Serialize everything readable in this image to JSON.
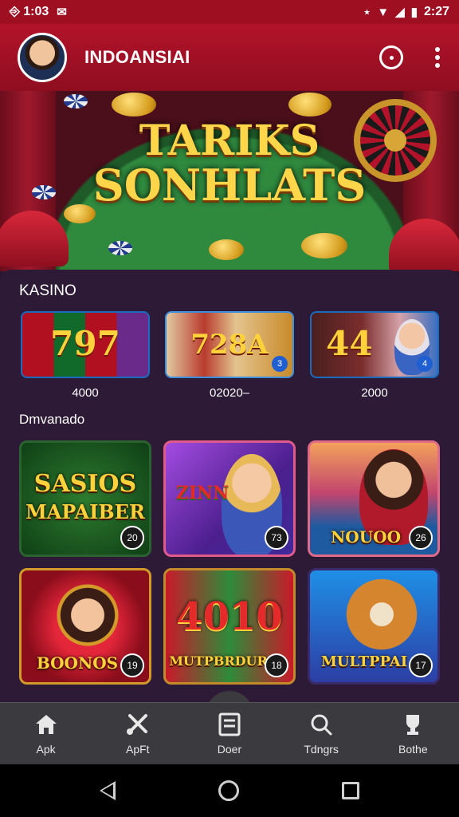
{
  "status_bar": {
    "left_text": "⎆ 1:03",
    "time": "2:27"
  },
  "app_bar": {
    "title": "INDOANSIAI"
  },
  "banner": {
    "line1": "TARIKS",
    "line2": "SONHLATS"
  },
  "sections": {
    "casino": "KASINO",
    "promo": "Dmvanado"
  },
  "casino_slots": [
    {
      "reel": "797",
      "caption": "4000",
      "badge": ""
    },
    {
      "reel": "728A",
      "caption": "02020–",
      "badge": "3"
    },
    {
      "reel": "44",
      "caption": "2000",
      "badge": "4"
    }
  ],
  "game_cards": [
    {
      "title_line1": "SASIOS",
      "title_line2": "MAPAIBER",
      "badge": "20"
    },
    {
      "title_line1": "ZINN",
      "title_line2": "",
      "badge": "73"
    },
    {
      "title_line1": "NOUOO",
      "title_line2": "",
      "badge": "26"
    },
    {
      "title_line1": "BOONOS",
      "title_line2": "",
      "badge": "19"
    },
    {
      "title_line1": "4010",
      "title_line2": "MUTPBRDUR",
      "badge": "18"
    },
    {
      "title_line1": "MULTPPAI",
      "title_line2": "",
      "badge": "17"
    }
  ],
  "bottom_nav": [
    {
      "label": "Apk",
      "icon": "home-icon"
    },
    {
      "label": "ApFt",
      "icon": "tools-icon"
    },
    {
      "label": "Doer",
      "icon": "document-icon"
    },
    {
      "label": "Tdngrs",
      "icon": "search-icon"
    },
    {
      "label": "Bothe",
      "icon": "trophy-icon"
    }
  ],
  "colors": {
    "primary": "#b3132a",
    "background": "#2a1732",
    "nav": "#3a3a3f"
  }
}
